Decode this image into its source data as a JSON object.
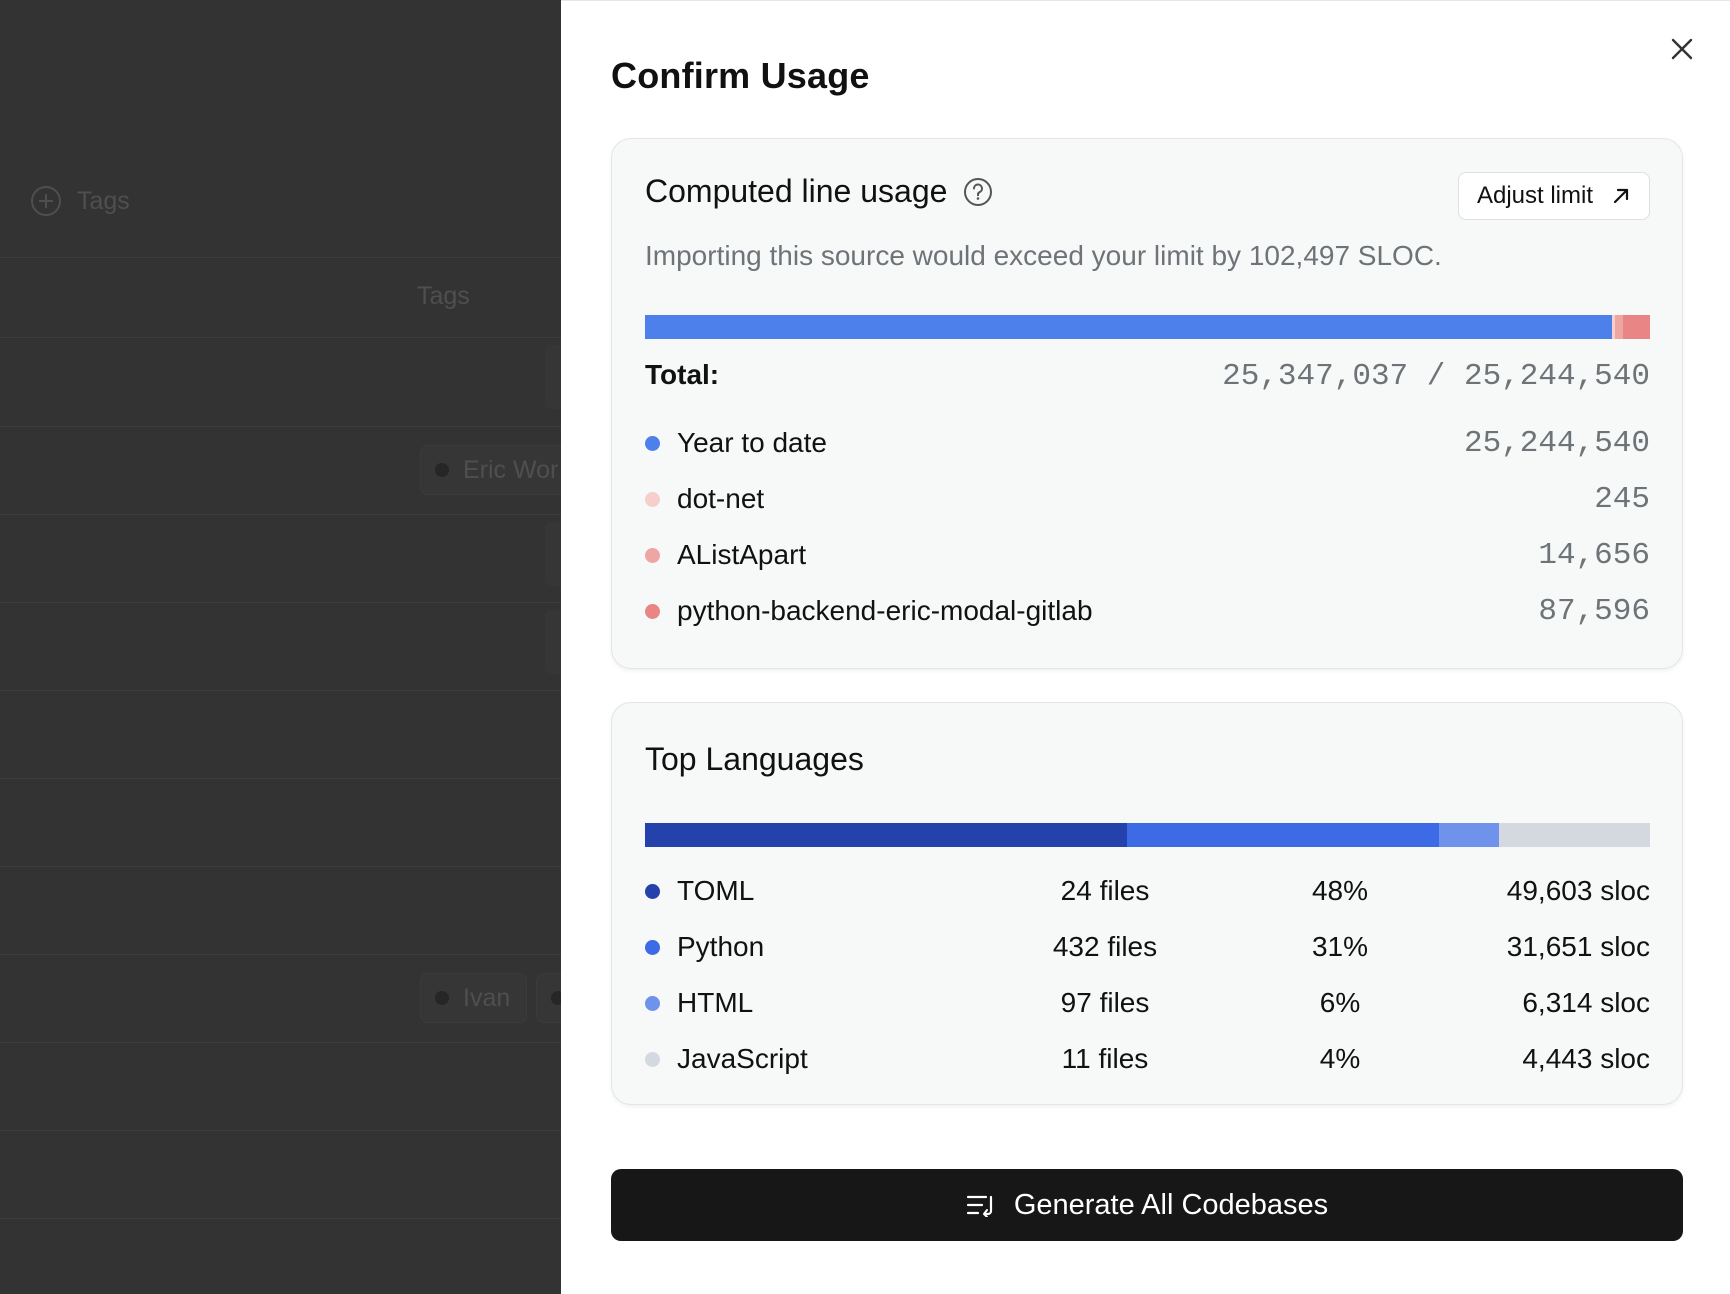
{
  "background": {
    "tags_button_label": "Tags",
    "column_header": "Tags",
    "chips": [
      "Eric Wor",
      "Ivan"
    ]
  },
  "drawer": {
    "title": "Confirm Usage",
    "close_icon": "close-icon"
  },
  "usage": {
    "heading": "Computed line usage",
    "adjust_limit_label": "Adjust limit",
    "message": "Importing this source would exceed your limit by 102,497 SLOC.",
    "total_label": "Total:",
    "total_value": "25,347,037 / 25,244,540",
    "items": [
      {
        "label": "Year to date",
        "value": "25,244,540",
        "amount": 25244540,
        "color": "#4d80ea"
      },
      {
        "label": "dot-net",
        "value": "245",
        "amount": 245,
        "color": "#f6cfcc"
      },
      {
        "label": "AListApart",
        "value": "14,656",
        "amount": 14656,
        "color": "#eea6a3"
      },
      {
        "label": "python-backend-eric-modal-gitlab",
        "value": "87,596",
        "amount": 87596,
        "color": "#e98685"
      }
    ],
    "bar_segments": [
      {
        "name": "Year to date",
        "fraction": 0.9625,
        "color": "#4d80ea"
      },
      {
        "name": "dot-net",
        "fraction": 0.003,
        "color": "#f6cfcc"
      },
      {
        "name": "AListApart",
        "fraction": 0.0075,
        "color": "#eea6a3"
      },
      {
        "name": "python-backend-eric-modal-gitlab",
        "fraction": 0.027,
        "color": "#e98685"
      }
    ]
  },
  "languages": {
    "heading": "Top Languages",
    "items": [
      {
        "name": "TOML",
        "files": "24 files",
        "percent": "48%",
        "sloc": "49,603 sloc",
        "fraction": 0.48,
        "color": "#2541ac"
      },
      {
        "name": "Python",
        "files": "432 files",
        "percent": "31%",
        "sloc": "31,651 sloc",
        "fraction": 0.31,
        "color": "#3d6ae5"
      },
      {
        "name": "HTML",
        "files": "97 files",
        "percent": "6%",
        "sloc": "6,314 sloc",
        "fraction": 0.06,
        "color": "#6f93ea"
      },
      {
        "name": "JavaScript",
        "files": "11 files",
        "percent": "4%",
        "sloc": "4,443 sloc",
        "fraction": 0.15,
        "color": "#d4d8e0"
      }
    ]
  },
  "generate_button_label": "Generate All Codebases"
}
